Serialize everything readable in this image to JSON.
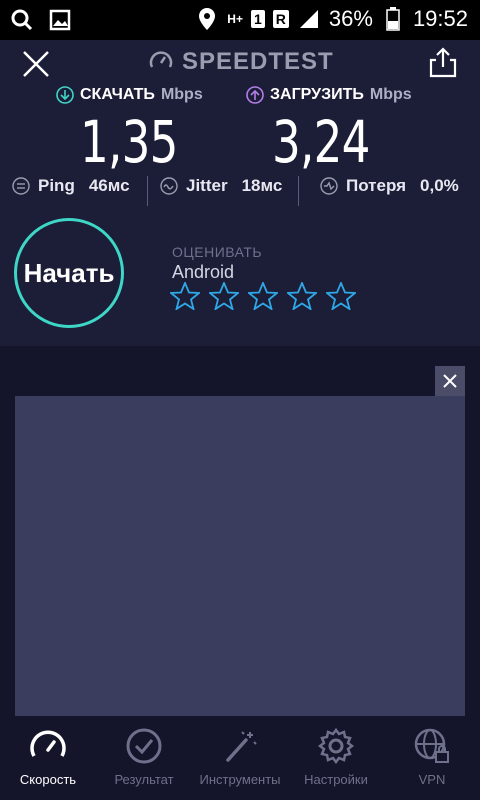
{
  "status_bar": {
    "battery": "36%",
    "time": "19:52",
    "network_badge": "1",
    "roaming_badge": "R",
    "data_badge": "H+"
  },
  "header": {
    "app_title": "SPEEDTEST"
  },
  "download": {
    "label": "СКАЧАТЬ",
    "unit": "Mbps",
    "value": "1,35",
    "color": "#3ed6c6"
  },
  "upload": {
    "label": "ЗАГРУЗИТЬ",
    "unit": "Mbps",
    "value": "3,24",
    "color": "#b47ee8"
  },
  "stats": {
    "ping_label": "Ping",
    "ping_value": "46мс",
    "jitter_label": "Jitter",
    "jitter_value": "18мс",
    "loss_label": "Потеря",
    "loss_value": "0,0%"
  },
  "start_button": {
    "label": "Начать",
    "ring_color": "#3ed6c6"
  },
  "rating": {
    "caption": "ОЦЕНИВАТЬ",
    "name": "Android",
    "stars_total": 5,
    "stars_filled": 0,
    "star_color": "#2fa8e8"
  },
  "bottom_nav": {
    "items": [
      {
        "label": "Скорость",
        "icon": "speedometer-icon",
        "active": true
      },
      {
        "label": "Результат",
        "icon": "check-circle-icon",
        "active": false
      },
      {
        "label": "Инструменты",
        "icon": "magic-wand-icon",
        "active": false
      },
      {
        "label": "Настройки",
        "icon": "gear-icon",
        "active": false
      },
      {
        "label": "VPN",
        "icon": "globe-lock-icon",
        "active": false
      }
    ]
  }
}
